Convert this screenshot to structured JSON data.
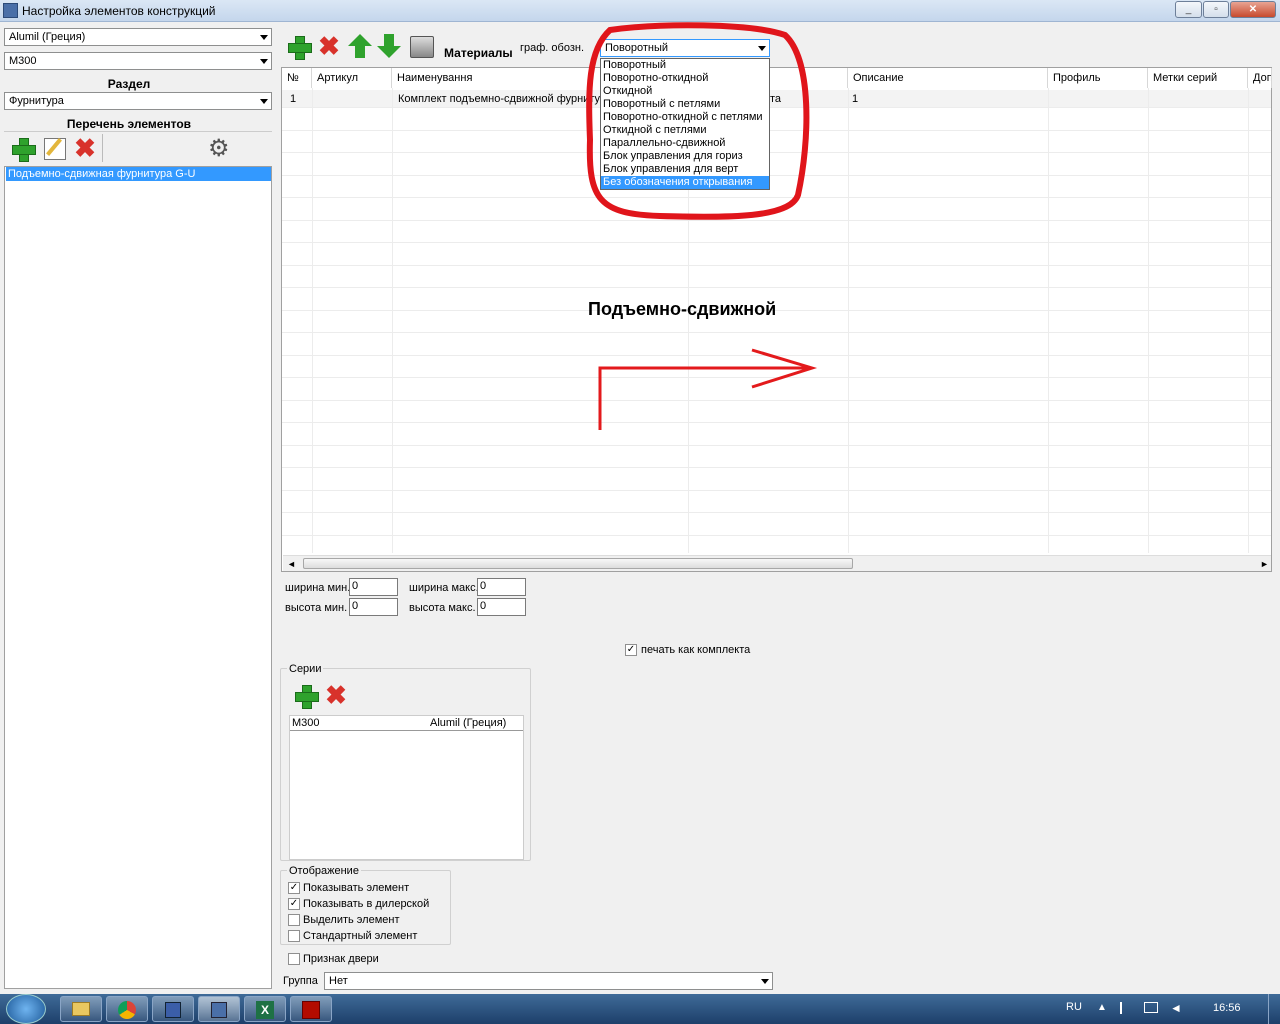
{
  "window": {
    "title": "Настройка элементов конструкций"
  },
  "left": {
    "vendor": "Alumil (Греция)",
    "series": "M300",
    "section_header": "Раздел",
    "section_value": "Фурнитура",
    "list_header": "Перечень элементов",
    "items": [
      "Подъемно-сдвижная фурнитура G-U"
    ]
  },
  "toolbar": {
    "materials_label": "Материалы",
    "graph_label": "граф. обозн.",
    "graph_value": "Поворотный"
  },
  "dropdown": {
    "options": [
      "Поворотный",
      "Поворотно-откидной",
      "Откидной",
      "Поворотный с петлями",
      "Поворотно-откидной с петлями",
      "Откидной с петлями",
      "Параллельно-сдвижной",
      "Блок управления для гориз",
      "Блок управления для верт",
      "Без обозначения открывания"
    ],
    "selected_index": 9
  },
  "table": {
    "columns": [
      "№",
      "Артикул",
      "Наименування",
      "Описание",
      "Профиль",
      "Метки серий",
      "Доп"
    ],
    "rows": [
      {
        "num": "1",
        "article": "",
        "name": "Комплект подъемно-сдвижной фурниту",
        "hidden_text": "та",
        "desc": "1"
      }
    ]
  },
  "preview": {
    "caption": "Подъемно-сдвижной",
    "arrow_color": "#e31a1c"
  },
  "dims": {
    "width_min_label": "ширина мин.",
    "width_min": "0",
    "width_max_label": "ширина макс.",
    "width_max": "0",
    "height_min_label": "высота мин.",
    "height_min": "0",
    "height_max_label": "высота макс.",
    "height_max": "0"
  },
  "print_as_kit": {
    "label": "печать как комплекта",
    "checked": true
  },
  "series_box": {
    "title": "Серии",
    "rows": [
      {
        "series": "M300",
        "vendor": "Alumil (Греция)"
      }
    ]
  },
  "display_box": {
    "title": "Отображение",
    "options": [
      {
        "label": "Показывать элемент",
        "checked": true
      },
      {
        "label": "Показывать в дилерской",
        "checked": true
      },
      {
        "label": "Выделить элемент",
        "checked": false
      },
      {
        "label": "Стандартный элемент",
        "checked": false
      }
    ]
  },
  "door_sign": {
    "label": "Признак двери",
    "checked": false
  },
  "group": {
    "label": "Группа",
    "value": "Нет"
  },
  "taskbar": {
    "lang": "RU",
    "time": "16:56"
  },
  "annotation_color": "#e0151b"
}
